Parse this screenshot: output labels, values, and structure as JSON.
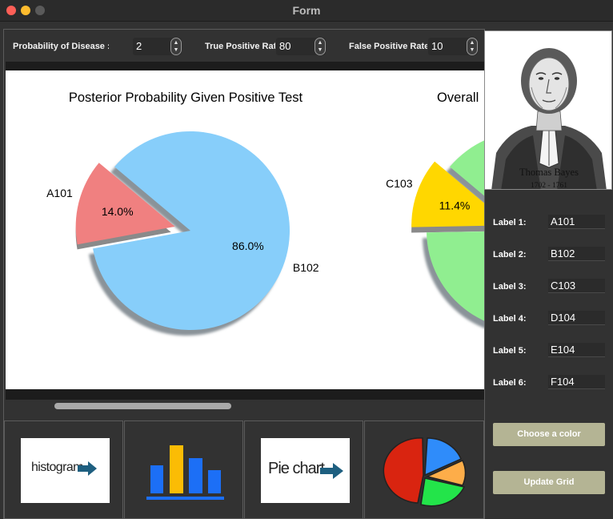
{
  "window": {
    "title": "Form"
  },
  "controls": {
    "probability": {
      "label": "Probability of Disease :",
      "value": "2"
    },
    "tpr": {
      "label": "True Positive Rate",
      "value": "80"
    },
    "fpr": {
      "label": "False Positive Rate",
      "value": "10"
    }
  },
  "chart_data": [
    {
      "type": "pie",
      "title": "Posterior Probability Given Positive Test",
      "labels": [
        "A101",
        "B102"
      ],
      "values": [
        14.0,
        86.0
      ],
      "value_labels": [
        "14.0%",
        "86.0%"
      ],
      "colors": [
        "#f08080",
        "#87cefa"
      ],
      "exploded": [
        "A101"
      ],
      "shadow": true
    },
    {
      "type": "pie",
      "title": "Overall",
      "labels": [
        "C103"
      ],
      "values": [
        11.4
      ],
      "value_labels": [
        "11.4%"
      ],
      "colors": [
        "#ffd700",
        "#90ee90"
      ],
      "exploded": [
        "C103"
      ],
      "shadow": true,
      "truncated": true
    }
  ],
  "portrait": {
    "name": "Thomas Bayes",
    "years": "1702 - 1761"
  },
  "labels": [
    {
      "label": "Label 1:",
      "value": "A101"
    },
    {
      "label": "Label 2:",
      "value": "B102"
    },
    {
      "label": "Label 3:",
      "value": "C103"
    },
    {
      "label": "Label 4:",
      "value": "D104"
    },
    {
      "label": "Label 5:",
      "value": "E104"
    },
    {
      "label": "Label 6:",
      "value": "F104"
    }
  ],
  "buttons": {
    "choose_color": "Choose a color",
    "update_grid": "Update Grid"
  },
  "thumbnails": {
    "histogram": "histogram",
    "pie_chart": "Pie chart"
  },
  "thumbnail_colors": {
    "bars": [
      "#1c6ff6",
      "#fbbc05",
      "#1c6ff6",
      "#1c6ff6"
    ],
    "pie": [
      "#d92410",
      "#2f8cfa",
      "#fdad49",
      "#23e44a"
    ],
    "arrow": "#1e5f80"
  }
}
